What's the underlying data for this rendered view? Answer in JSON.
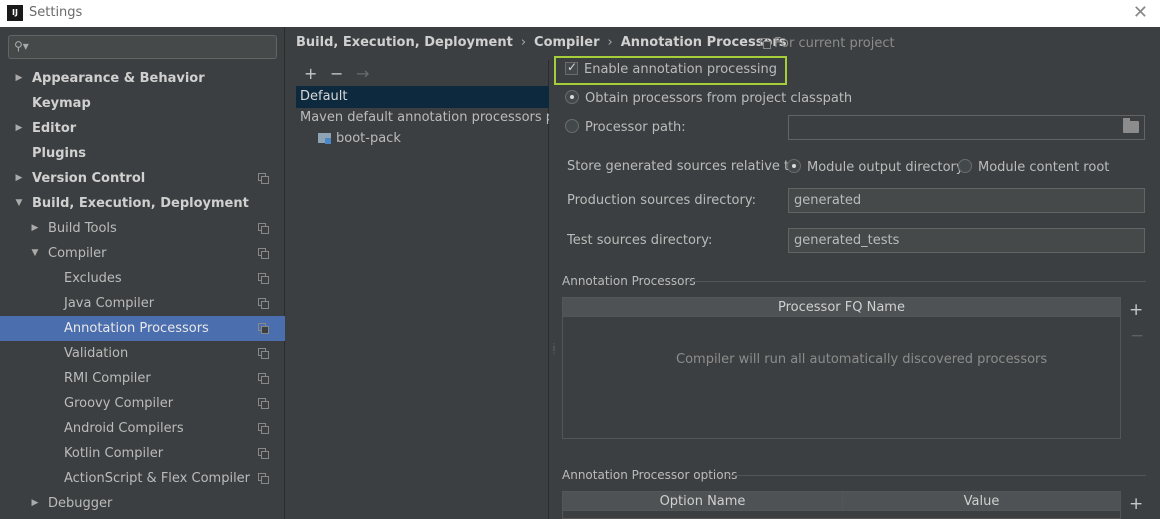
{
  "window": {
    "title": "Settings",
    "app_icon": "IJ"
  },
  "sidebar": {
    "search_value": "",
    "items": [
      {
        "label": "Appearance & Behavior",
        "bold": true,
        "arrow": "▶",
        "level": 0
      },
      {
        "label": "Keymap",
        "bold": true,
        "arrow": "",
        "level": 0
      },
      {
        "label": "Editor",
        "bold": true,
        "arrow": "▶",
        "level": 0
      },
      {
        "label": "Plugins",
        "bold": true,
        "arrow": "",
        "level": 0
      },
      {
        "label": "Version Control",
        "bold": true,
        "arrow": "▶",
        "level": 0,
        "copy": true
      },
      {
        "label": "Build, Execution, Deployment",
        "bold": true,
        "arrow": "▼",
        "level": 0
      },
      {
        "label": "Build Tools",
        "bold": false,
        "arrow": "▶",
        "level": 1,
        "copy": true
      },
      {
        "label": "Compiler",
        "bold": false,
        "arrow": "▼",
        "level": 1,
        "copy": true
      },
      {
        "label": "Excludes",
        "bold": false,
        "arrow": "",
        "level": 2,
        "copy": true
      },
      {
        "label": "Java Compiler",
        "bold": false,
        "arrow": "",
        "level": 2,
        "copy": true
      },
      {
        "label": "Annotation Processors",
        "bold": false,
        "arrow": "",
        "level": 2,
        "copy": true,
        "selected": true
      },
      {
        "label": "Validation",
        "bold": false,
        "arrow": "",
        "level": 2,
        "copy": true
      },
      {
        "label": "RMI Compiler",
        "bold": false,
        "arrow": "",
        "level": 2,
        "copy": true
      },
      {
        "label": "Groovy Compiler",
        "bold": false,
        "arrow": "",
        "level": 2,
        "copy": true
      },
      {
        "label": "Android Compilers",
        "bold": false,
        "arrow": "",
        "level": 2,
        "copy": true
      },
      {
        "label": "Kotlin Compiler",
        "bold": false,
        "arrow": "",
        "level": 2,
        "copy": true
      },
      {
        "label": "ActionScript & Flex Compiler",
        "bold": false,
        "arrow": "",
        "level": 2,
        "copy": true
      },
      {
        "label": "Debugger",
        "bold": false,
        "arrow": "▶",
        "level": 1
      }
    ]
  },
  "breadcrumb": {
    "items": [
      "Build, Execution, Deployment",
      "Compiler",
      "Annotation Processors"
    ],
    "separator": "›",
    "scope": "For current project"
  },
  "profiles": {
    "toolbar": {
      "add": "+",
      "remove": "−",
      "move": "→"
    },
    "items": [
      "Default",
      "Maven default annotation processors profile",
      "boot-pack"
    ]
  },
  "form": {
    "enable_label": "Enable annotation processing",
    "enable_checked": true,
    "obtain_from_classpath": "Obtain processors from project classpath",
    "processor_path_label": "Processor path:",
    "processor_path_value": "",
    "store_label": "Store generated sources relative to:",
    "store_options": [
      "Module output directory",
      "Module content root"
    ],
    "store_selected": 0,
    "production_label": "Production sources directory:",
    "production_value": "generated",
    "test_label": "Test sources directory:",
    "test_value": "generated_tests"
  },
  "processors_section": {
    "title": "Annotation Processors",
    "column": "Processor FQ Name",
    "empty_text": "Compiler will run all automatically discovered processors",
    "add": "+",
    "remove": "−"
  },
  "options_section": {
    "title": "Annotation Processor options",
    "columns": [
      "Option Name",
      "Value"
    ],
    "add": "+"
  },
  "colors": {
    "background": "#3c3f41",
    "selection": "#4b6eaf",
    "highlight_box": "#a6ce39",
    "profile_selection": "#0d293e"
  }
}
